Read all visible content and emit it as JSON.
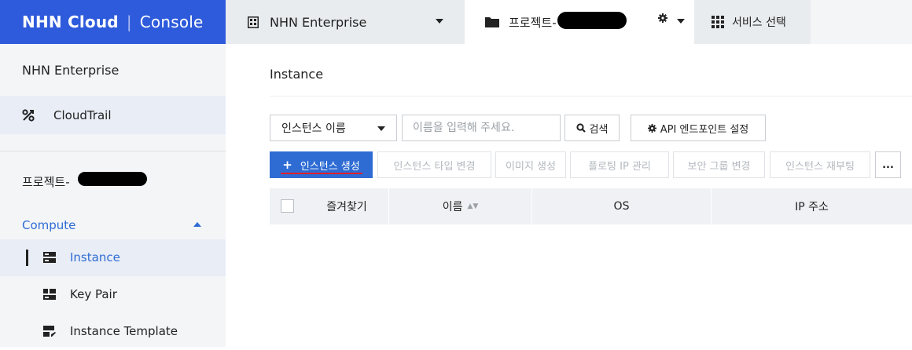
{
  "topbar": {
    "brand_logo": "NHN Cloud",
    "brand_sep": "|",
    "brand_console": "Console",
    "org_name": "NHN Enterprise",
    "project_label": "프로젝트-",
    "services_label": "서비스 선택"
  },
  "sidebar": {
    "org_name": "NHN Enterprise",
    "cloudtrail_label": "CloudTrail",
    "project_label": "프로젝트-",
    "compute_label": "Compute",
    "items": [
      {
        "label": "Instance",
        "icon": "server-icon",
        "active": true
      },
      {
        "label": "Key Pair",
        "icon": "key-pair-icon",
        "active": false
      },
      {
        "label": "Instance Template",
        "icon": "template-icon",
        "active": false
      }
    ]
  },
  "main": {
    "title": "Instance",
    "filter_select": "인스턴스 이름",
    "search_placeholder": "이름을 입력해 주세요.",
    "search_button": "검색",
    "api_button": "API 엔드포인트 설정",
    "create_button": "인스턴스 생성",
    "create_plus": "+",
    "actions": [
      "인스턴스 타입 변경",
      "이미지 생성",
      "플로팅 IP 관리",
      "보안 그룹 변경",
      "인스턴스 재부팅"
    ],
    "more_button": "...",
    "table_headers": {
      "favorite": "즐겨찾기",
      "name": "이름",
      "name_sort": "▲▼",
      "os": "OS",
      "ip": "IP 주소"
    }
  },
  "colors": {
    "brand": "#2e5bdb",
    "accent": "#2e6cd4",
    "redaction": "#000000",
    "underline": "#e0202a"
  }
}
